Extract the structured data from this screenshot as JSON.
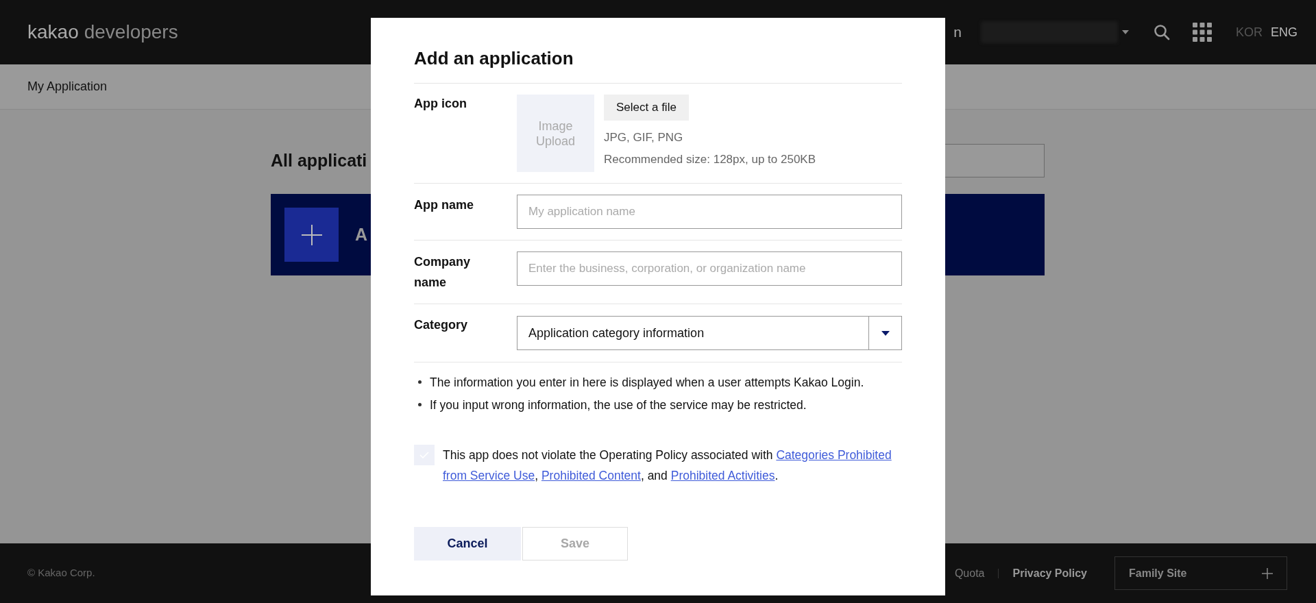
{
  "header": {
    "logo": {
      "brand": "kakao",
      "product": "developers"
    },
    "nav_fragment": "n",
    "languages": [
      {
        "label": "KOR",
        "selected": false
      },
      {
        "label": "ENG",
        "selected": true
      }
    ]
  },
  "breadcrumb": "My Application",
  "page": {
    "heading": "All applicati",
    "add_banner_text": "A"
  },
  "footer": {
    "copyright": "© Kakao Corp.",
    "links": [
      {
        "label": "Quota",
        "bold": false
      },
      {
        "label": "Privacy Policy",
        "bold": true
      }
    ],
    "family_site": "Family Site"
  },
  "dialog": {
    "title": "Add an application",
    "app_icon": {
      "label": "App icon",
      "upload_text": "Image\nUpload",
      "button": "Select a file",
      "formats": "JPG, GIF, PNG",
      "size_hint": "Recommended size: 128px, up to 250KB"
    },
    "fields": [
      {
        "label": "App name",
        "placeholder": "My application name"
      },
      {
        "label": "Company name",
        "placeholder": "Enter the business, corporation, or organization name"
      }
    ],
    "category": {
      "label": "Category",
      "value": "Application category information"
    },
    "notes": [
      "The information you enter in here is displayed when a user attempts Kakao Login.",
      "If you input wrong information, the use of the service may be restricted."
    ],
    "agreement": {
      "checked": false,
      "parts": [
        {
          "kind": "text",
          "text": "This app does not violate the Operating Policy associated with "
        },
        {
          "kind": "link",
          "text": "Categories Prohibited"
        },
        {
          "kind": "link",
          "text": "from Service Use"
        },
        {
          "kind": "text",
          "text": ", "
        },
        {
          "kind": "link",
          "text": "Prohibited Content"
        },
        {
          "kind": "text",
          "text": ", and "
        },
        {
          "kind": "link",
          "text": "Prohibited Activities"
        },
        {
          "kind": "text",
          "text": "."
        }
      ]
    },
    "buttons": [
      {
        "label": "Cancel",
        "disabled": false
      },
      {
        "label": "Save",
        "disabled": true
      }
    ]
  }
}
